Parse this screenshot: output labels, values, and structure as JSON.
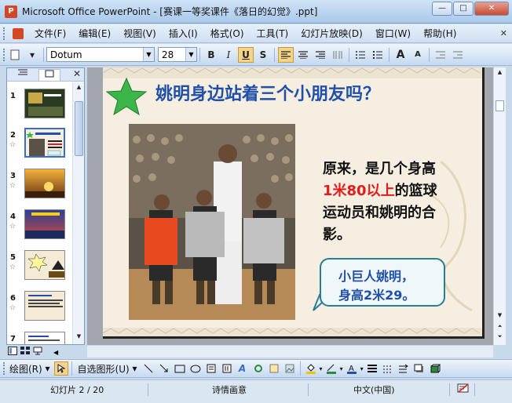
{
  "window": {
    "title": "Microsoft Office PowerPoint - [赛课一等奖课件《落日的幻觉》.ppt]",
    "minimize": "—",
    "maximize": "□",
    "close": "✕",
    "app_icon": "powerpoint-icon"
  },
  "menu": {
    "items": [
      "文件(F)",
      "编辑(E)",
      "视图(V)",
      "插入(I)",
      "格式(O)",
      "工具(T)",
      "幻灯片放映(D)",
      "窗口(W)",
      "帮助(H)"
    ],
    "close_doc": "✕"
  },
  "toolbar": {
    "font": "Dotum",
    "size": "28",
    "bold": "B",
    "italic": "I",
    "underline": "U",
    "shadow": "S",
    "grow_font": "A",
    "shrink_font": "A"
  },
  "pane": {
    "close": "✕",
    "slides": [
      {
        "num": "1"
      },
      {
        "num": "2"
      },
      {
        "num": "3"
      },
      {
        "num": "4"
      },
      {
        "num": "5"
      },
      {
        "num": "6"
      },
      {
        "num": "7"
      }
    ]
  },
  "slide": {
    "title": "姚明身边站着三个小朋友吗？",
    "body_line1": "原来，是几个身高",
    "body_red": "1米80以上",
    "body_line2": "的篮球",
    "body_line3": "运动员和姚明的合",
    "body_line4": "影。",
    "callout_line1": "小巨人姚明，",
    "callout_line2": "身高2米29。"
  },
  "drawbar": {
    "draw": "绘图(R)",
    "autoshape": "自选图形(U)"
  },
  "status": {
    "slide_pos": "幻灯片 2 / 20",
    "design": "诗情画意",
    "language": "中文(中国)"
  },
  "colors": {
    "title_blue": "#1f4fa8",
    "highlight_red": "#e21b1b",
    "slide_bg": "#f6efe1"
  }
}
